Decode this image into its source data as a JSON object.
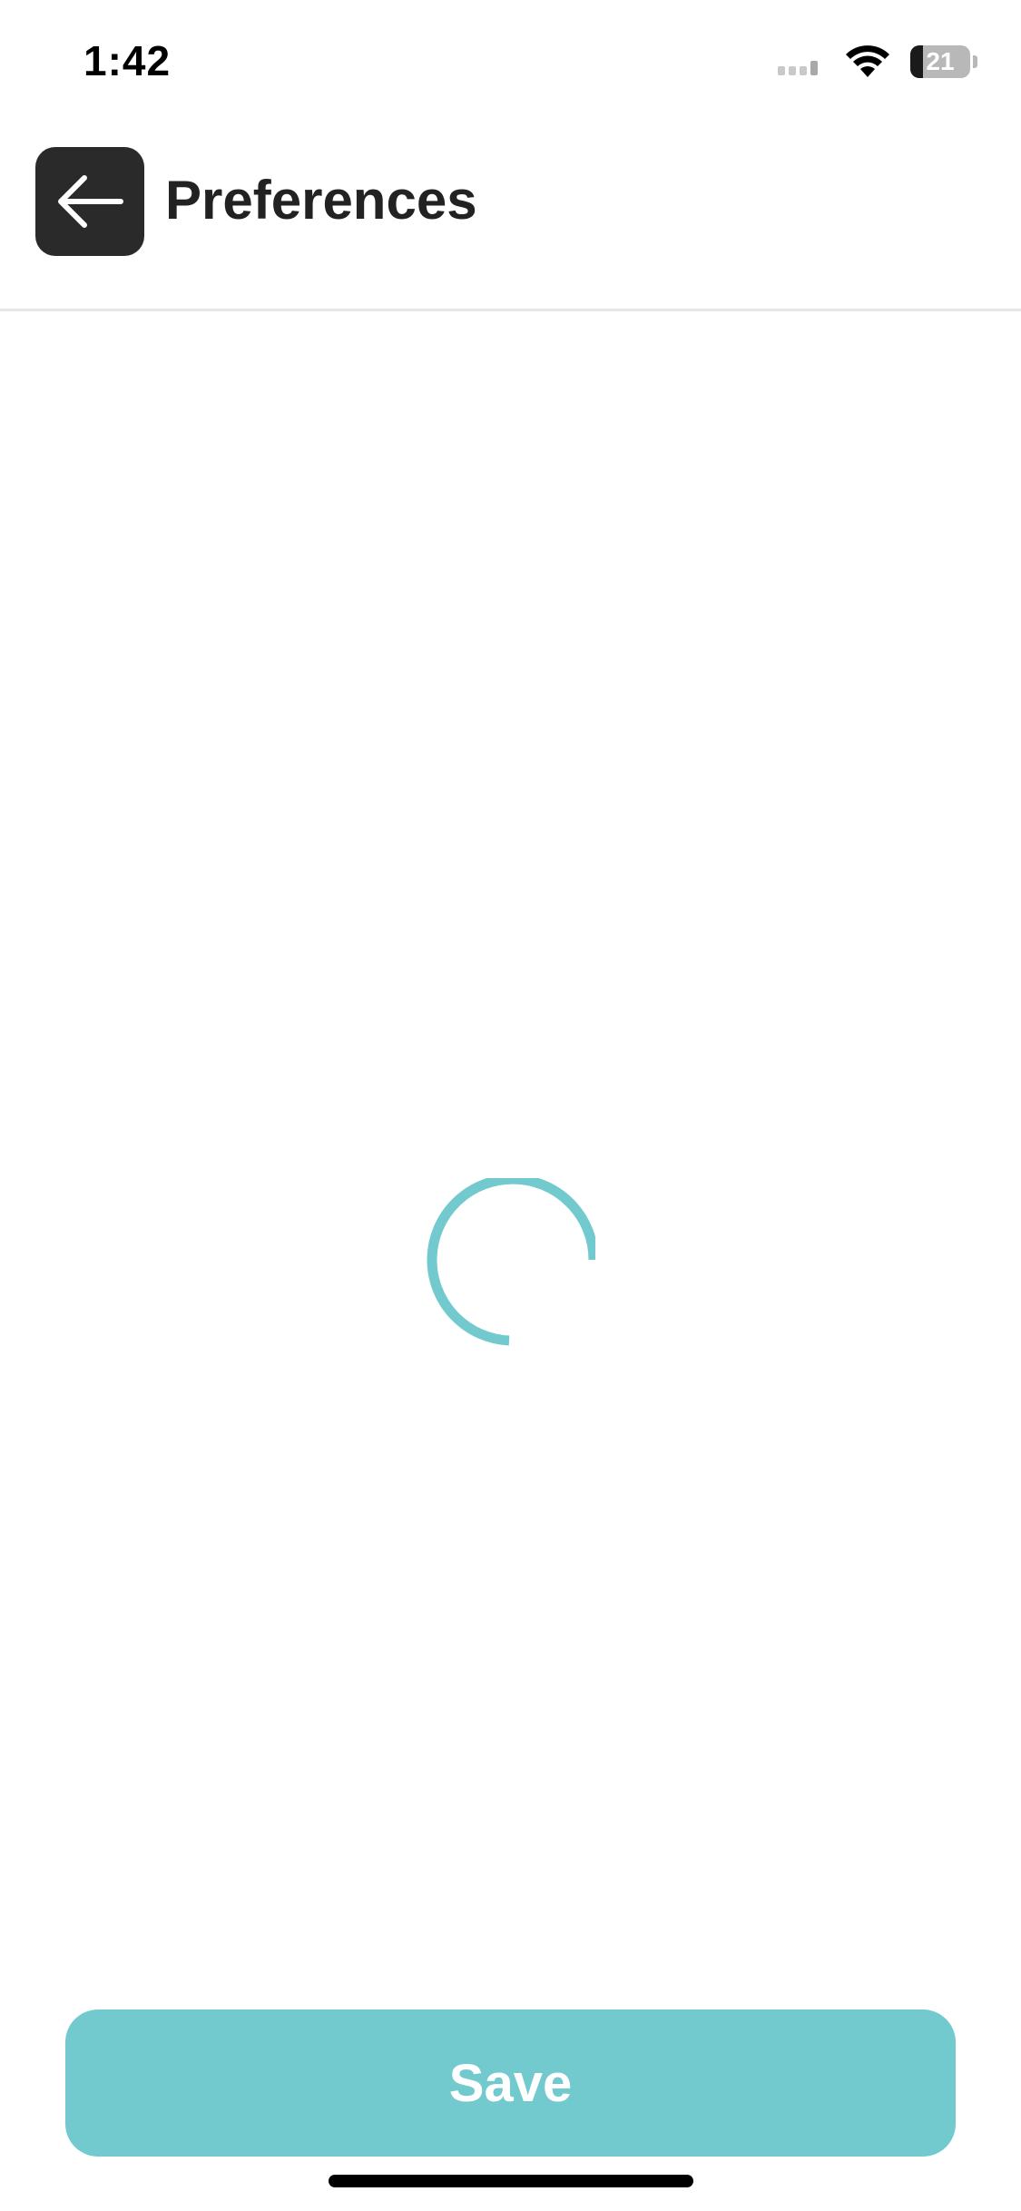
{
  "status_bar": {
    "time": "1:42",
    "battery_level": 21,
    "battery_text": "21",
    "icons": [
      "cellular-signal-icon",
      "wifi-icon",
      "battery-icon"
    ]
  },
  "header": {
    "back_icon": "arrow-left-icon",
    "title": "Preferences"
  },
  "content": {
    "state": "loading",
    "spinner_icon": "loading-spinner-icon"
  },
  "footer": {
    "save_label": "Save"
  },
  "colors": {
    "accent": "#72cace",
    "spinner": "#72cace",
    "header_button": "#2a2a2a",
    "title_text": "#222222",
    "divider": "#e6e6e6"
  }
}
